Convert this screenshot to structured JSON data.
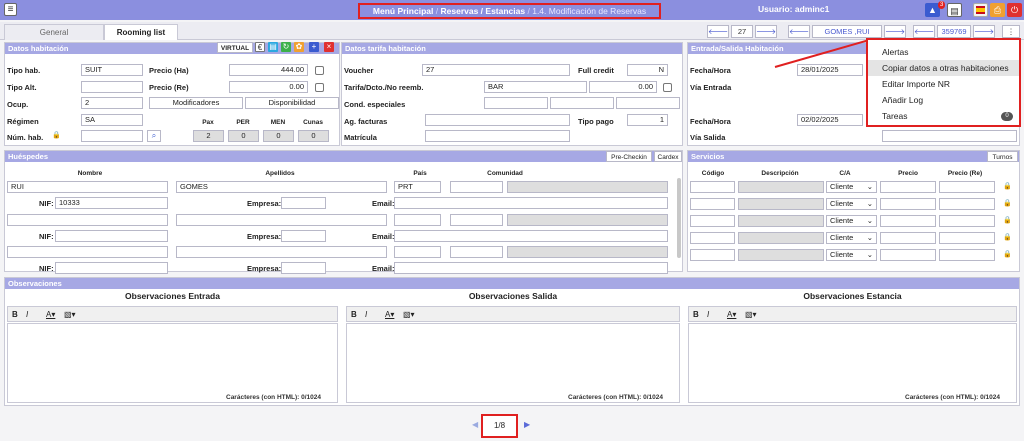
{
  "topbar": {
    "breadcrumb": [
      "Menú Principal",
      "Reservas / Estancias",
      "1.4. Modificación de Reservas"
    ],
    "separator": "/",
    "user_label": "Usuario: adminc1",
    "notif_count": "3"
  },
  "tabs": [
    "General",
    "Rooming list"
  ],
  "nav": {
    "index": "27",
    "guest": "GOMES ,RUI",
    "code": "359769",
    "more": "⋮"
  },
  "room": {
    "title": "Datos habitación",
    "virtual_label": "VIRTUAL",
    "tipo_hab_label": "Tipo hab.",
    "tipo_hab": "SUIT",
    "tipo_alt_label": "Tipo Alt.",
    "tipo_alt": "",
    "ocup_label": "Ocup.",
    "ocup": "2",
    "regimen_label": "Régimen",
    "regimen": "SA",
    "num_hab_label": "Núm. hab.",
    "precio_ha_label": "Precio (Ha)",
    "precio_ha": "444.00",
    "precio_re_label": "Precio (Re)",
    "precio_re": "0.00",
    "modificadores": "Modificadores",
    "disponibilidad": "Disponibilidad",
    "pax_headers": [
      "Pax",
      "PER",
      "MEN",
      "Cunas"
    ],
    "pax_values": [
      "2",
      "0",
      "0",
      "0"
    ]
  },
  "tarifa": {
    "title": "Datos tarifa habitación",
    "voucher_label": "Voucher",
    "voucher": "27",
    "full_credit_label": "Full credit",
    "full_credit": "N",
    "tarifa_label": "Tarifa/Dcto./No reemb.",
    "tarifa": "BAR",
    "tarifa_amount": "0.00",
    "cond_label": "Cond. especiales",
    "ag_label": "Ag. facturas",
    "tipo_pago_label": "Tipo pago",
    "tipo_pago": "1",
    "matricula_label": "Matrícula"
  },
  "entrada": {
    "title": "Entrada/Salida Habitación",
    "fecha_label": "Fecha/Hora",
    "fecha_entrada": "28/01/2025",
    "via_entrada_label": "Vía Entrada",
    "fecha_salida": "02/02/2025",
    "via_salida_label": "Vía Salida"
  },
  "dropdown": {
    "items": [
      "Alertas",
      "Copiar datos a otras habitaciones",
      "Editar Importe NR",
      "Añadir Log",
      "Tareas"
    ],
    "tareas_count": "0"
  },
  "huespedes": {
    "title": "Huéspedes",
    "precheckin": "Pre-Checkin",
    "cardex": "Cardex",
    "col_nombre": "Nombre",
    "col_apellidos": "Apellidos",
    "col_pais": "País",
    "col_comunidad": "Comunidad",
    "nif_label": "NIF:",
    "empresa_label": "Empresa:",
    "email_label": "Email:",
    "guest1": {
      "nombre": "RUI",
      "apellidos": "GOMES",
      "pais": "PRT",
      "nif": "10333"
    }
  },
  "servicios": {
    "title": "Servicios",
    "turnos": "Turnos",
    "headers": [
      "Código",
      "Descripción",
      "C/A",
      "Precio",
      "Precio (Re)"
    ],
    "ca_value": "Cliente"
  },
  "observaciones": {
    "title": "Observaciones",
    "entrada": "Observaciones Entrada",
    "salida": "Observaciones Salida",
    "estancia": "Observaciones Estancia",
    "counter": "Carácteres (con HTML): 0/1024"
  },
  "pager": {
    "page": "1/8"
  },
  "colors": {
    "header": "#8b8fdf",
    "section_head": "#a6a8e4",
    "highlight": "#e02020"
  }
}
